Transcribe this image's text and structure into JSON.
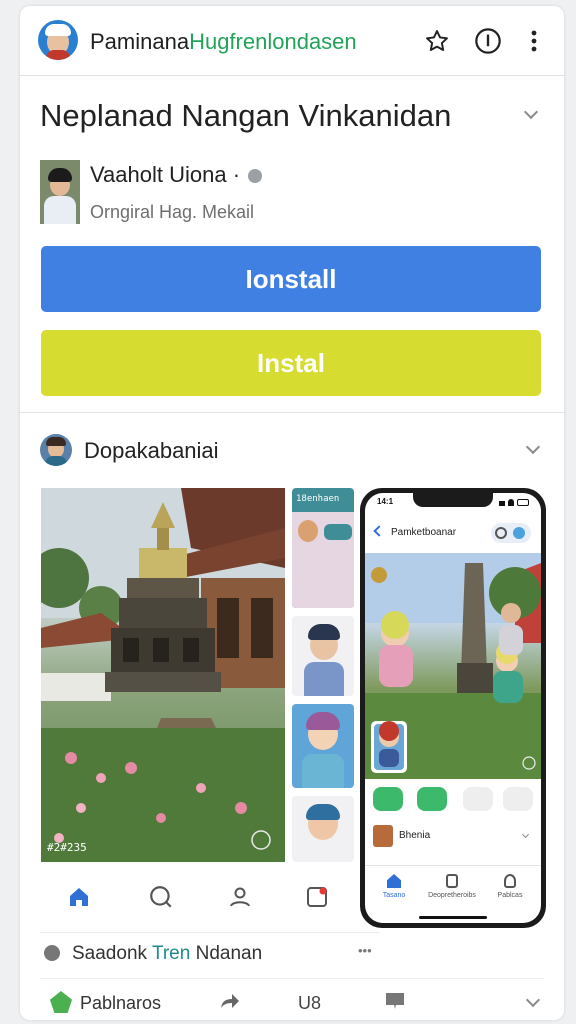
{
  "header": {
    "app_title_main": "Paminana",
    "app_title_accent": "Hugfrenlondasen",
    "star_icon": "star-outline-icon",
    "info_icon": "info-icon",
    "menu_icon": "more-vert-icon"
  },
  "app": {
    "title": "Neplanad Nangan Vinkanidan",
    "publisher_name": "Vaaholt Uiona ·",
    "publisher_sub": "Orngiral Hag. Mekail"
  },
  "buttons": {
    "primary_label": "Ionstall",
    "secondary_label": "Instal"
  },
  "section": {
    "title": "Dopakabaniai"
  },
  "gallery": {
    "main_caption": "#2#235",
    "thumb_header": "18enhaen"
  },
  "phone": {
    "status_time": "14:1",
    "screen_title": "Pamketboanar",
    "user_name": "Bhenia",
    "nav": [
      "Tasano",
      "Deopretheroibs",
      "Pablcas"
    ]
  },
  "bottom_row": {
    "label_main": "Saadonk ",
    "label_accent": "Tren",
    "label_tail": " Ndanan",
    "more": "•••"
  },
  "footer_row": {
    "label": "Pablnaros",
    "mid": "U8"
  },
  "colors": {
    "primary_button": "#3f80e2",
    "secondary_button": "#d6dc30",
    "accent_green": "#21a35a",
    "nav_blue": "#2f6fd6"
  }
}
